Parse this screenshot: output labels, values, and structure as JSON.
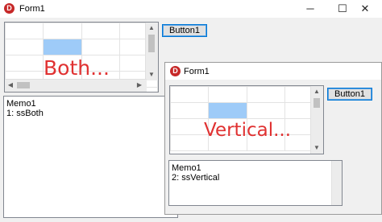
{
  "window1": {
    "icon": "delphi-app-icon",
    "title": "Form1",
    "controls": {
      "minimize": "─",
      "maximize": "☐",
      "close": "✕"
    },
    "button_label": "Button1",
    "grid": {
      "overlay_text": "Both...",
      "scrollbars": "both"
    },
    "memo": {
      "lines": [
        "Memo1",
        "1: ssBoth"
      ]
    }
  },
  "window2": {
    "icon": "delphi-app-icon",
    "title": "Form1",
    "button_label": "Button1",
    "grid": {
      "overlay_text": "Vertical...",
      "scrollbars": "vertical"
    },
    "memo": {
      "lines": [
        "Memo1",
        "2: ssVertical"
      ]
    }
  },
  "colors": {
    "selected_cell": "#9ecbf8",
    "overlay_text": "#e03131",
    "focus_border": "#0078d7"
  }
}
